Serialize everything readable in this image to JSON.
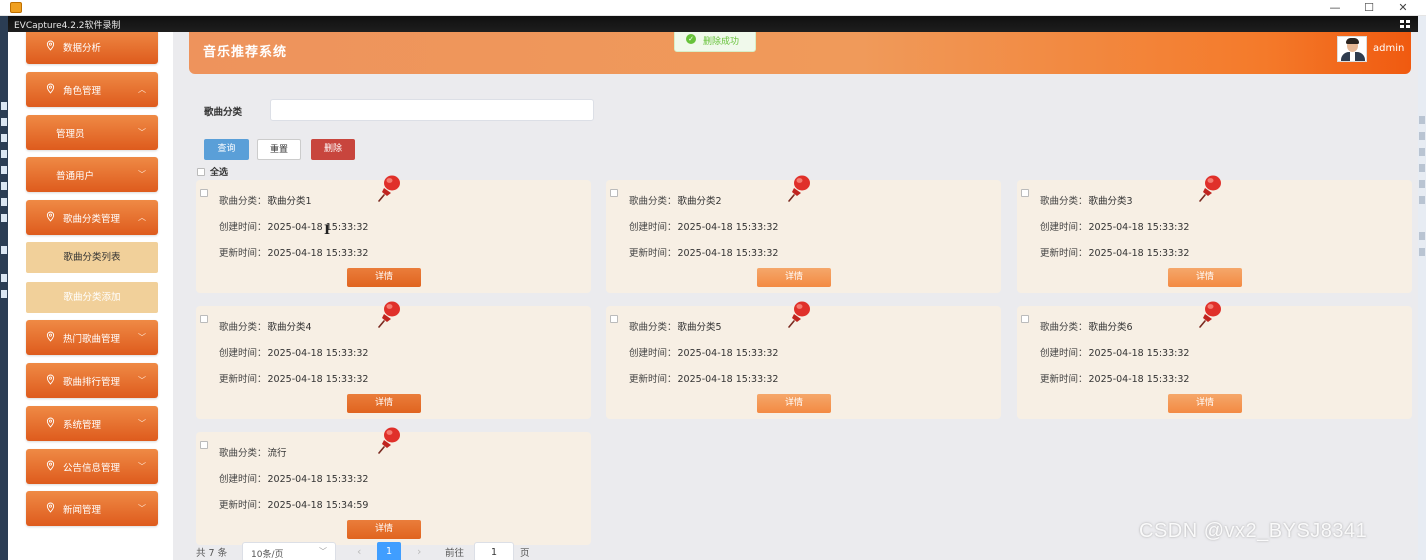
{
  "window": {
    "minimize": "—",
    "maximize": "☐",
    "close": "✕"
  },
  "capture_bar": {
    "title": "EVCapture4.2.2软件录制"
  },
  "header": {
    "title": "音乐推荐系统",
    "user": "admin"
  },
  "toast": {
    "message": "删除成功"
  },
  "sidebar": {
    "items": [
      {
        "label": "数据分析",
        "chevron": ""
      },
      {
        "label": "角色管理",
        "chevron": "︿"
      },
      {
        "label": "管理员",
        "chevron": "﹀"
      },
      {
        "label": "普通用户",
        "chevron": "﹀"
      },
      {
        "label": "歌曲分类管理",
        "chevron": "︿"
      },
      {
        "label": "热门歌曲管理",
        "chevron": "﹀"
      },
      {
        "label": "歌曲排行管理",
        "chevron": "﹀"
      },
      {
        "label": "系统管理",
        "chevron": "﹀"
      },
      {
        "label": "公告信息管理",
        "chevron": "﹀"
      },
      {
        "label": "新闻管理",
        "chevron": "﹀"
      }
    ],
    "sub_items": [
      {
        "label": "歌曲分类列表"
      },
      {
        "label": "歌曲分类添加"
      }
    ]
  },
  "filter": {
    "label": "歌曲分类",
    "value": "",
    "placeholder": ""
  },
  "buttons": {
    "query": "查询",
    "reset": "重置",
    "delete": "删除"
  },
  "select_all": "全选",
  "field_labels": {
    "category": "歌曲分类：",
    "created": "创建时间：",
    "updated": "更新时间："
  },
  "detail_label": "详情",
  "cards": [
    {
      "category": "歌曲分类1",
      "created": "2025-04-18 15:33:32",
      "updated": "2025-04-18 15:33:32"
    },
    {
      "category": "歌曲分类2",
      "created": "2025-04-18 15:33:32",
      "updated": "2025-04-18 15:33:32"
    },
    {
      "category": "歌曲分类3",
      "created": "2025-04-18 15:33:32",
      "updated": "2025-04-18 15:33:32"
    },
    {
      "category": "歌曲分类4",
      "created": "2025-04-18 15:33:32",
      "updated": "2025-04-18 15:33:32"
    },
    {
      "category": "歌曲分类5",
      "created": "2025-04-18 15:33:32",
      "updated": "2025-04-18 15:33:32"
    },
    {
      "category": "歌曲分类6",
      "created": "2025-04-18 15:33:32",
      "updated": "2025-04-18 15:33:32"
    },
    {
      "category": "流行",
      "created": "2025-04-18 15:33:32",
      "updated": "2025-04-18 15:34:59"
    }
  ],
  "pagination": {
    "total": "共 7 条",
    "page_size": "10条/页",
    "prev": "‹",
    "current": "1",
    "next": "›",
    "goto_label": "前往",
    "goto_value": "1",
    "page_suffix": "页"
  },
  "watermark": "CSDN @vx2_BYSJ8341",
  "colors": {
    "accent": "#e0641f",
    "header_start": "#ee935c",
    "header_end": "#f05a10",
    "card_bg": "#f7efe4",
    "sub_item_bg": "#f1d09a",
    "query_button": "#5a9fd8",
    "delete_button": "#c8453d",
    "pager_active": "#409eff",
    "success": "#67c23a"
  }
}
